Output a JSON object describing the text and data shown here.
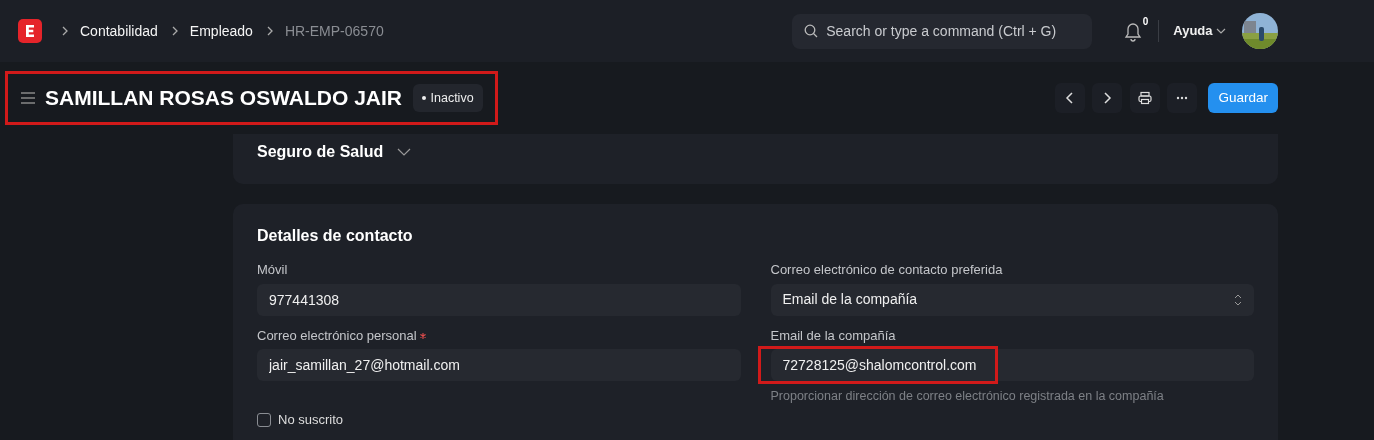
{
  "navbar": {
    "breadcrumbs": [
      {
        "label": "Contabilidad",
        "current": false
      },
      {
        "label": "Empleado",
        "current": false
      },
      {
        "label": "HR-EMP-06570",
        "current": true
      }
    ],
    "search": {
      "placeholder": "Search or type a command (Ctrl + G)"
    },
    "notifications": {
      "count": "0"
    },
    "help": "Ayuda"
  },
  "header": {
    "title": "SAMILLAN ROSAS OSWALDO JAIR",
    "status": "Inactivo",
    "annotated": true,
    "primary_button": "Guardar"
  },
  "sections": [
    {
      "title": "Seguro de Salud",
      "collapsed": true
    },
    {
      "title": "Detalles de contacto",
      "fields": [
        {
          "kind": "input",
          "label": "Móvil",
          "value": "977441308"
        },
        {
          "kind": "select",
          "label": "Correo electrónico de contacto preferida",
          "value": "Email de la compañía"
        },
        {
          "kind": "input",
          "label": "Correo electrónico personal",
          "value": "jair_samillan_27@hotmail.com",
          "required": true
        },
        {
          "kind": "input",
          "label": "Email de la compañía",
          "value": "72728125@shalomcontrol.com",
          "annotated": true,
          "help": "Proporcionar dirección de correo electrónico registrada en la compañía"
        },
        {
          "kind": "checkbox",
          "label": "No suscrito",
          "checked": false
        }
      ]
    }
  ]
}
